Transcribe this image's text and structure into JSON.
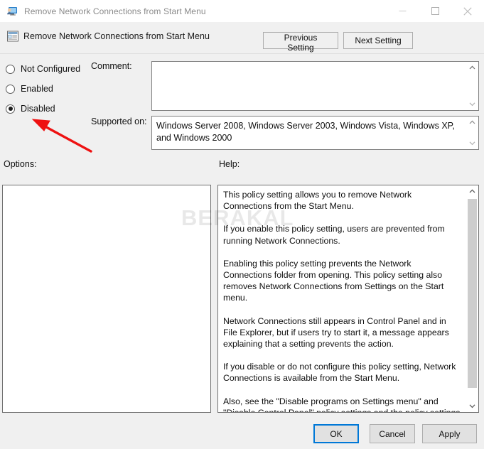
{
  "window": {
    "title": "Remove Network Connections from Start Menu",
    "icon": "policy-monitor-icon",
    "minimize_label": "Minimize",
    "maximize_label": "Maximize",
    "close_label": "Close"
  },
  "header": {
    "title": "Remove Network Connections from Start Menu",
    "icon": "policy-setting-icon",
    "previous_label": "Previous Setting",
    "next_label": "Next Setting"
  },
  "state": {
    "options": [
      {
        "label": "Not Configured",
        "selected": false
      },
      {
        "label": "Enabled",
        "selected": false
      },
      {
        "label": "Disabled",
        "selected": true
      }
    ],
    "selected_value": "Disabled"
  },
  "comment": {
    "label": "Comment:",
    "value": "",
    "placeholder": ""
  },
  "supported_on": {
    "label": "Supported on:",
    "value": "Windows Server 2008, Windows Server 2003, Windows Vista, Windows XP, and Windows 2000"
  },
  "options_panel": {
    "label": "Options:",
    "content": ""
  },
  "help_panel": {
    "label": "Help:",
    "paragraphs": [
      "This policy setting allows you to remove Network Connections from the Start Menu.",
      "If you enable this policy setting, users are prevented from running Network Connections.",
      "Enabling this policy setting prevents the Network Connections folder from opening. This policy setting also removes Network Connections from Settings on the Start menu.",
      "Network Connections still appears in Control Panel and in File Explorer, but if users try to start it, a message appears explaining that a setting prevents the action.",
      "If you disable or do not configure this policy setting, Network Connections is available from the Start Menu.",
      "Also, see the \"Disable programs on Settings menu\" and \"Disable Control Panel\" policy settings and the policy settings in the Network Connections folder (Computer Configuration and User Configuration\\Administrative Templates\\Network\\Network Connections)."
    ]
  },
  "footer": {
    "ok_label": "OK",
    "cancel_label": "Cancel",
    "apply_label": "Apply"
  },
  "watermark": {
    "text": "BERAKAL"
  },
  "annotation": {
    "type": "red-arrow",
    "points_to": "Disabled",
    "color": "#ee1111"
  }
}
